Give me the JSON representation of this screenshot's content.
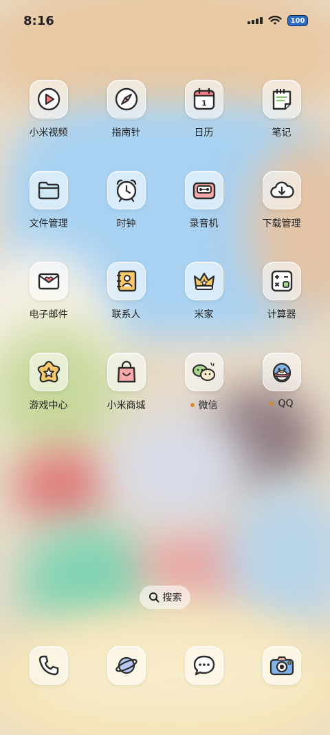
{
  "status_bar": {
    "time": "8:16",
    "battery": "100",
    "icons": [
      "signal-icon",
      "wifi-icon",
      "battery-icon"
    ]
  },
  "apps": [
    {
      "label": "小米视频",
      "icon": "video-play-icon"
    },
    {
      "label": "指南针",
      "icon": "compass-icon"
    },
    {
      "label": "日历",
      "icon": "calendar-icon",
      "date": "1"
    },
    {
      "label": "笔记",
      "icon": "notes-icon"
    },
    {
      "label": "文件管理",
      "icon": "folder-icon"
    },
    {
      "label": "时钟",
      "icon": "alarm-clock-icon"
    },
    {
      "label": "录音机",
      "icon": "cassette-icon"
    },
    {
      "label": "下载管理",
      "icon": "cloud-download-icon"
    },
    {
      "label": "电子邮件",
      "icon": "mail-heart-icon"
    },
    {
      "label": "联系人",
      "icon": "contacts-book-icon"
    },
    {
      "label": "米家",
      "icon": "crown-icon"
    },
    {
      "label": "计算器",
      "icon": "calculator-icon"
    },
    {
      "label": "游戏中心",
      "icon": "star-flower-icon"
    },
    {
      "label": "小米商城",
      "icon": "shopping-bag-icon"
    },
    {
      "label": "微信",
      "icon": "wechat-icon",
      "badge": true
    },
    {
      "label": "QQ",
      "icon": "qq-penguin-icon",
      "badge": true
    }
  ],
  "search": {
    "label": "搜索",
    "icon": "search-icon"
  },
  "dock": [
    {
      "icon": "phone-icon"
    },
    {
      "icon": "browser-planet-icon"
    },
    {
      "icon": "messages-icon"
    },
    {
      "icon": "camera-icon"
    }
  ],
  "colors": {
    "label_text": "#222222",
    "badge_dot": "#d48c2e",
    "battery_fill": "#2d6cc7"
  }
}
